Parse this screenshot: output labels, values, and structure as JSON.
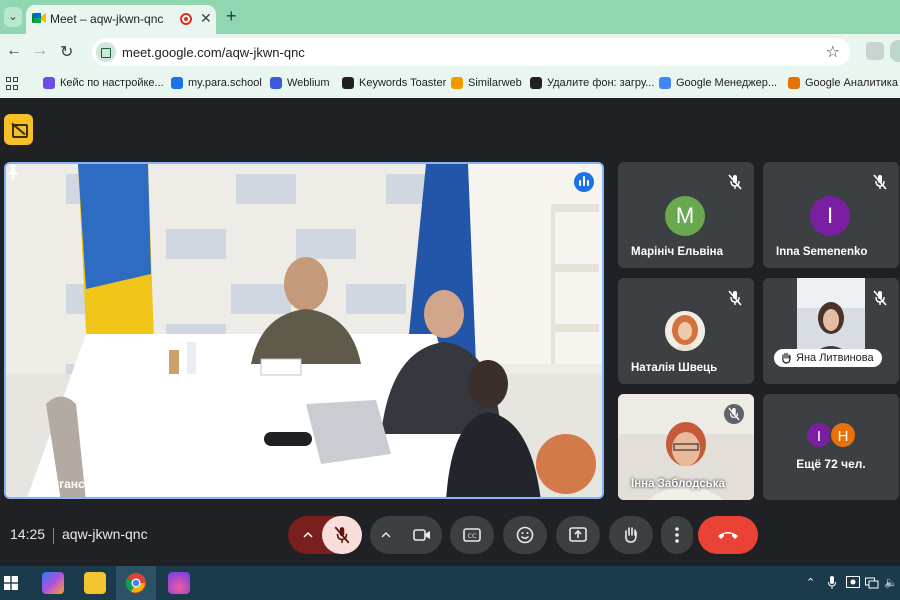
{
  "browser": {
    "tab_title": "Meet – aqw-jkwn-qnc",
    "close_glyph": "✕",
    "new_tab_glyph": "+",
    "url": "meet.google.com/aqw-jkwn-qnc",
    "bookmarks": [
      {
        "label": "Кейс по настройке...",
        "color": "#6b4ce6"
      },
      {
        "label": "my.para.school",
        "color": "#1a73e8"
      },
      {
        "label": "Weblium",
        "color": "#3b5bdb"
      },
      {
        "label": "Keywords Toaster",
        "color": "#202124"
      },
      {
        "label": "Similarweb",
        "color": "#f29900"
      },
      {
        "label": "Удалите фон: загру...",
        "color": "#202124"
      },
      {
        "label": "Google Менеджер...",
        "color": "#4285f4"
      },
      {
        "label": "Google Аналитика",
        "color": "#e37400"
      }
    ]
  },
  "meet": {
    "main_tile": {
      "name": "Луганська ОВА"
    },
    "participants": [
      {
        "name": "Марініч Ельвіна",
        "initial": "M",
        "avatar_color": "#6aa84f"
      },
      {
        "name": "Inna Semenenko",
        "initial": "I",
        "avatar_color": "#7b1fa2"
      },
      {
        "name": "Наталія Швець"
      },
      {
        "name": "Яна Литвинова"
      },
      {
        "name": "Інна Заблодська"
      }
    ],
    "more": {
      "label": "Ещё 72 чел.",
      "initials": [
        "I",
        "Н"
      ],
      "colors": [
        "#7b1fa2",
        "#e8710a"
      ]
    },
    "time": "14:25",
    "meeting_code": "aqw-jkwn-qnc"
  },
  "colors": {
    "accent": "#8ab4f8",
    "end_call": "#ea4335",
    "mic_off": "#f9dedc"
  }
}
